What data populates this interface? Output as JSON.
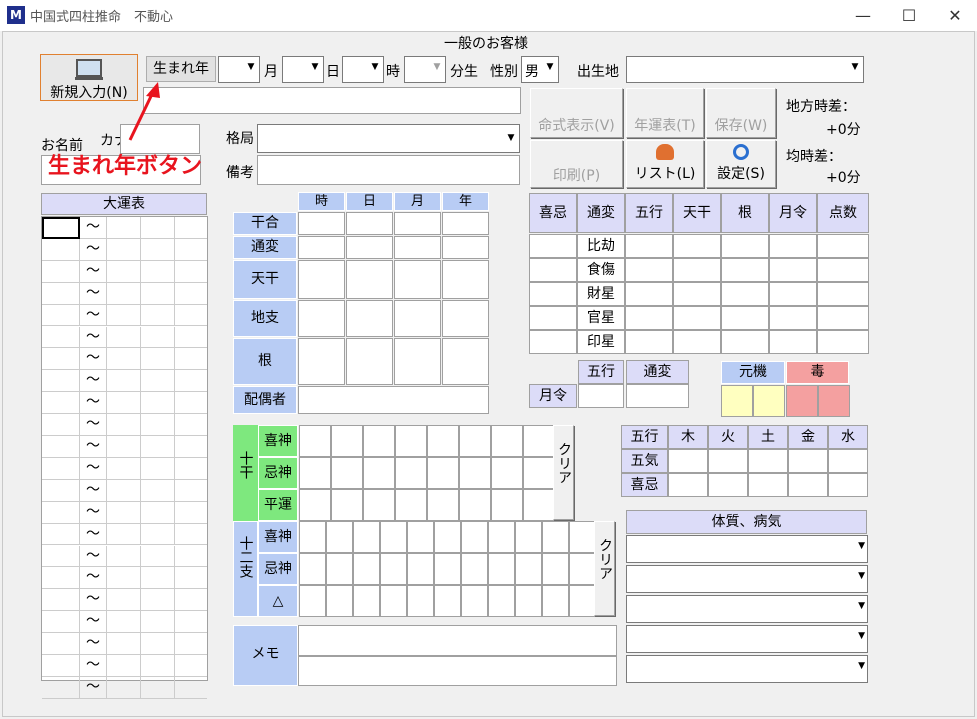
{
  "window": {
    "title": "中国式四柱推命　不動心",
    "minimize_icon": "—",
    "maximize_icon": "☐",
    "close_icon": "✕",
    "app_icon": "M"
  },
  "header": {
    "customer": "一般のお客様"
  },
  "top": {
    "new_entry": "新規入力(N)",
    "birth_year_button": "生まれ年",
    "month": "月",
    "day": "日",
    "hour": "時",
    "min": "分生",
    "gender_label": "性別",
    "gender_value": "男",
    "birthplace_label": "出生地",
    "name_label": "お名前",
    "kana_label": "カナ",
    "kakkyoku_label": "格局",
    "biko_label": "備考",
    "annotation": "生まれ年ボタン"
  },
  "actions": {
    "meishiki": "命式表示(V)",
    "nenunhyo": "年運表(T)",
    "hozon": "保存(W)",
    "insatsu": "印刷(P)",
    "list": "リスト(L)",
    "settei": "設定(S)"
  },
  "time_diff": {
    "chiho_label": "地方時差：",
    "chiho_value": "+0分",
    "kin_label": "均時差：",
    "kin_value": "+0分"
  },
  "daiun": {
    "title": "大運表",
    "rows": [
      "〜",
      "〜",
      "〜",
      "〜",
      "〜",
      "〜",
      "〜",
      "〜",
      "〜",
      "〜",
      "〜",
      "〜",
      "〜",
      "〜",
      "〜",
      "〜",
      "〜",
      "〜",
      "〜",
      "〜",
      "〜",
      "〜"
    ]
  },
  "pillars": {
    "cols": [
      "時",
      "日",
      "月",
      "年"
    ],
    "rows": [
      "干合",
      "通変",
      "天干",
      "地支",
      "根",
      "配偶者"
    ]
  },
  "power": {
    "cols": [
      "喜忌",
      "通変",
      "五行",
      "天干",
      "根",
      "月令",
      "点数"
    ],
    "rows": [
      "比劫",
      "食傷",
      "財星",
      "官星",
      "印星"
    ]
  },
  "getsurei": {
    "label": "月令",
    "cols": [
      "五行",
      "通変"
    ]
  },
  "genki": {
    "genki": "元機",
    "doku": "毒"
  },
  "jikkan": {
    "group": "十干",
    "rows": [
      "喜神",
      "忌神",
      "平運"
    ],
    "clear": "クリア"
  },
  "junishi": {
    "group": "十二支",
    "rows": [
      "喜神",
      "忌神",
      "△"
    ],
    "clear": "クリア"
  },
  "memo": {
    "label": "メモ"
  },
  "gogyo": {
    "cols": [
      "五行",
      "木",
      "火",
      "土",
      "金",
      "水"
    ],
    "rows": [
      "五気",
      "喜忌"
    ]
  },
  "taishitsu": {
    "title": "体質、病気",
    "count": 5
  },
  "colors": {
    "header_blue": "#b8ccf4",
    "green": "#7ee87e",
    "yellow": "#ffffc0",
    "pink": "#f4a0a0",
    "annotation_red": "#e8141e"
  }
}
